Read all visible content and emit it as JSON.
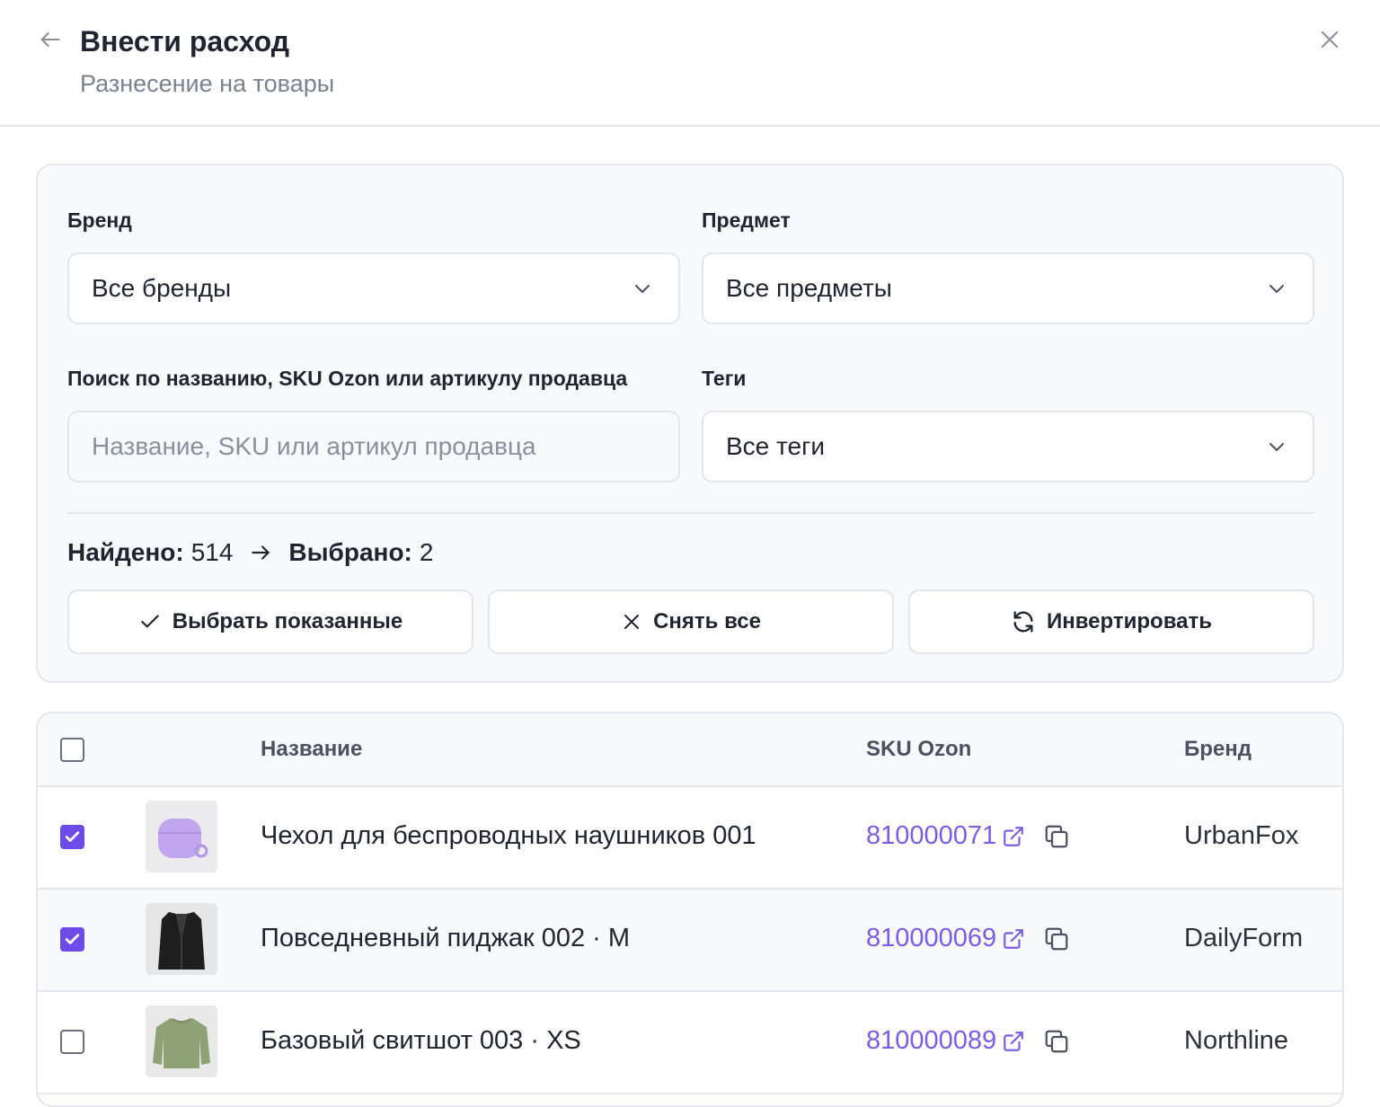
{
  "header": {
    "title": "Внести расход",
    "subtitle": "Разнесение на товары"
  },
  "filters": {
    "brand_label": "Бренд",
    "brand_value": "Все бренды",
    "subject_label": "Предмет",
    "subject_value": "Все предметы",
    "search_label": "Поиск по названию, SKU Ozon или артикулу продавца",
    "search_placeholder": "Название, SKU или артикул продавца",
    "search_value": "",
    "tags_label": "Теги",
    "tags_value": "Все теги"
  },
  "summary": {
    "found_label": "Найдено:",
    "found_count": "514",
    "selected_label": "Выбрано:",
    "selected_count": "2"
  },
  "actions": {
    "select_shown": "Выбрать показанные",
    "clear_all": "Снять все",
    "invert": "Инвертировать"
  },
  "table": {
    "columns": [
      "Название",
      "SKU Ozon",
      "Бренд"
    ],
    "rows": [
      {
        "checked": true,
        "name": "Чехол для беспроводных наушников 001",
        "sku": "810000071",
        "brand": "UrbanFox",
        "thumb": "airpods-case"
      },
      {
        "checked": true,
        "name": "Повседневный пиджак 002 · M",
        "sku": "810000069",
        "brand": "DailyForm",
        "thumb": "blazer"
      },
      {
        "checked": false,
        "name": "Базовый свитшот 003 · XS",
        "sku": "810000089",
        "brand": "Northline",
        "thumb": "sweatshirt"
      }
    ]
  },
  "colors": {
    "accent": "#6d4be8",
    "link": "#7b5ce6",
    "panel_bg": "#f8f9fb",
    "border": "#e4e7ec"
  }
}
